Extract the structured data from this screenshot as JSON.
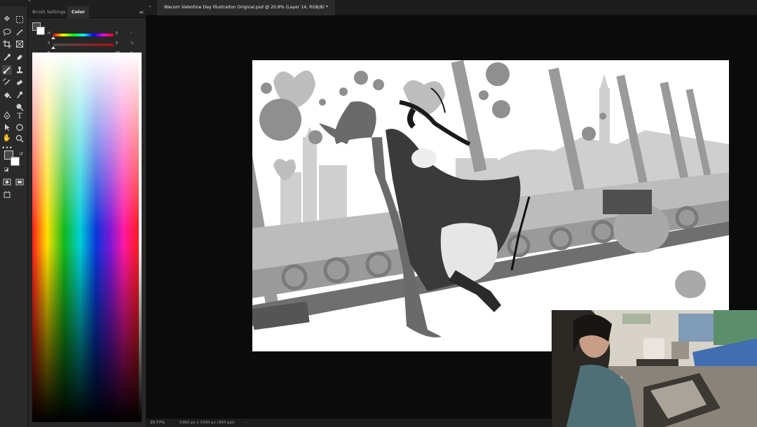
{
  "panel": {
    "tabs": [
      "Brush Settings",
      "Color"
    ],
    "active_tab": "Color",
    "sliders": [
      {
        "label": "H",
        "value": "0",
        "unit": "°",
        "position": 0.0
      },
      {
        "label": "S",
        "value": "0",
        "unit": "%",
        "position": 0.0
      },
      {
        "label": "B",
        "value": "55",
        "unit": "%",
        "position": 0.55
      }
    ]
  },
  "document": {
    "title": "Wacom Valentine Day Illustraiton Original.psd @ 20.8% (Layer 14, RGB/8) *"
  },
  "status": {
    "zoom": "20.77%",
    "size": "5382 px x 3300 px (300 ppi)"
  },
  "colors": {
    "foreground": "#4a4a4a",
    "background": "#ffffff",
    "workspace": "#0b0b0b",
    "panel": "#272727"
  },
  "icons": [
    "move-icon",
    "marquee-icon",
    "lasso-icon",
    "magic-wand-icon",
    "crop-icon",
    "frame-icon",
    "eyedropper-icon",
    "healing-icon",
    "brush-icon",
    "stamp-icon",
    "history-brush-icon",
    "eraser-icon",
    "paint-bucket-icon",
    "smudge-icon",
    "dodge-icon",
    "pen-icon",
    "type-icon",
    "path-select-icon",
    "ellipse-icon",
    "hand-icon",
    "zoom-icon",
    "more-icon",
    "swap-colors-icon",
    "default-colors-icon",
    "quick-mask-icon",
    "screen-mode-icon",
    "artboard-icon"
  ]
}
